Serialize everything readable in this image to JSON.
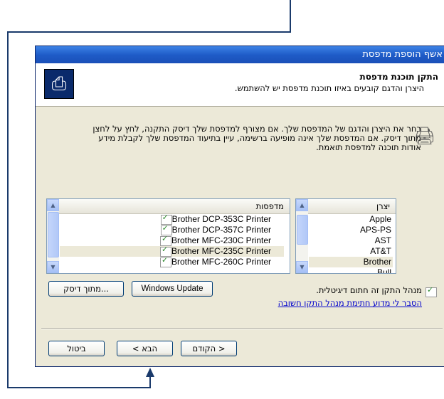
{
  "window": {
    "title": "אשף הוספת מדפסת"
  },
  "header": {
    "title": "התקן תוכנת מדפסת",
    "subtitle": "היצרן והדגם קובעים באיזו תוכנת מדפסת יש להשתמש.",
    "icon": "printer-wizard-icon"
  },
  "intro": {
    "text": "בחר את היצרן והדגם של המדפסת שלך. אם מצורף למדפסת שלך דיסק התקנה, לחץ על לחצן מתוך דיסק. אם המדפסת שלך אינה מופיעה ברשימה, עיין בתיעוד המדפסת שלך לקבלת מידע אודות תוכנה למדפסת תואמת.",
    "icon": "printer-icon"
  },
  "manufacturers": {
    "header": "יצרן",
    "items": [
      "Apple",
      "APS-PS",
      "AST",
      "AT&T",
      "Brother",
      "Bull"
    ],
    "selected": "Brother"
  },
  "printers": {
    "header": "מדפסות",
    "items": [
      "Brother DCP-353C Printer",
      "Brother DCP-357C Printer",
      "Brother MFC-230C Printer",
      "Brother MFC-235C Printer",
      "Brother MFC-260C Printer"
    ],
    "selected": "Brother MFC-235C Printer",
    "item_icon": "signed-driver-icon"
  },
  "buttons": {
    "windows_update": "Windows Update",
    "have_disk": "...מתוך דיסק",
    "back": "< הקודם",
    "next": "הבא >",
    "cancel": "ביטול"
  },
  "driver_signing": {
    "text": "מנהל התקן זה חתום דיגיטלית.",
    "link": "הסבר לי מדוע חתימת מנהל התקן חשובה",
    "icon": "signed-driver-icon"
  }
}
